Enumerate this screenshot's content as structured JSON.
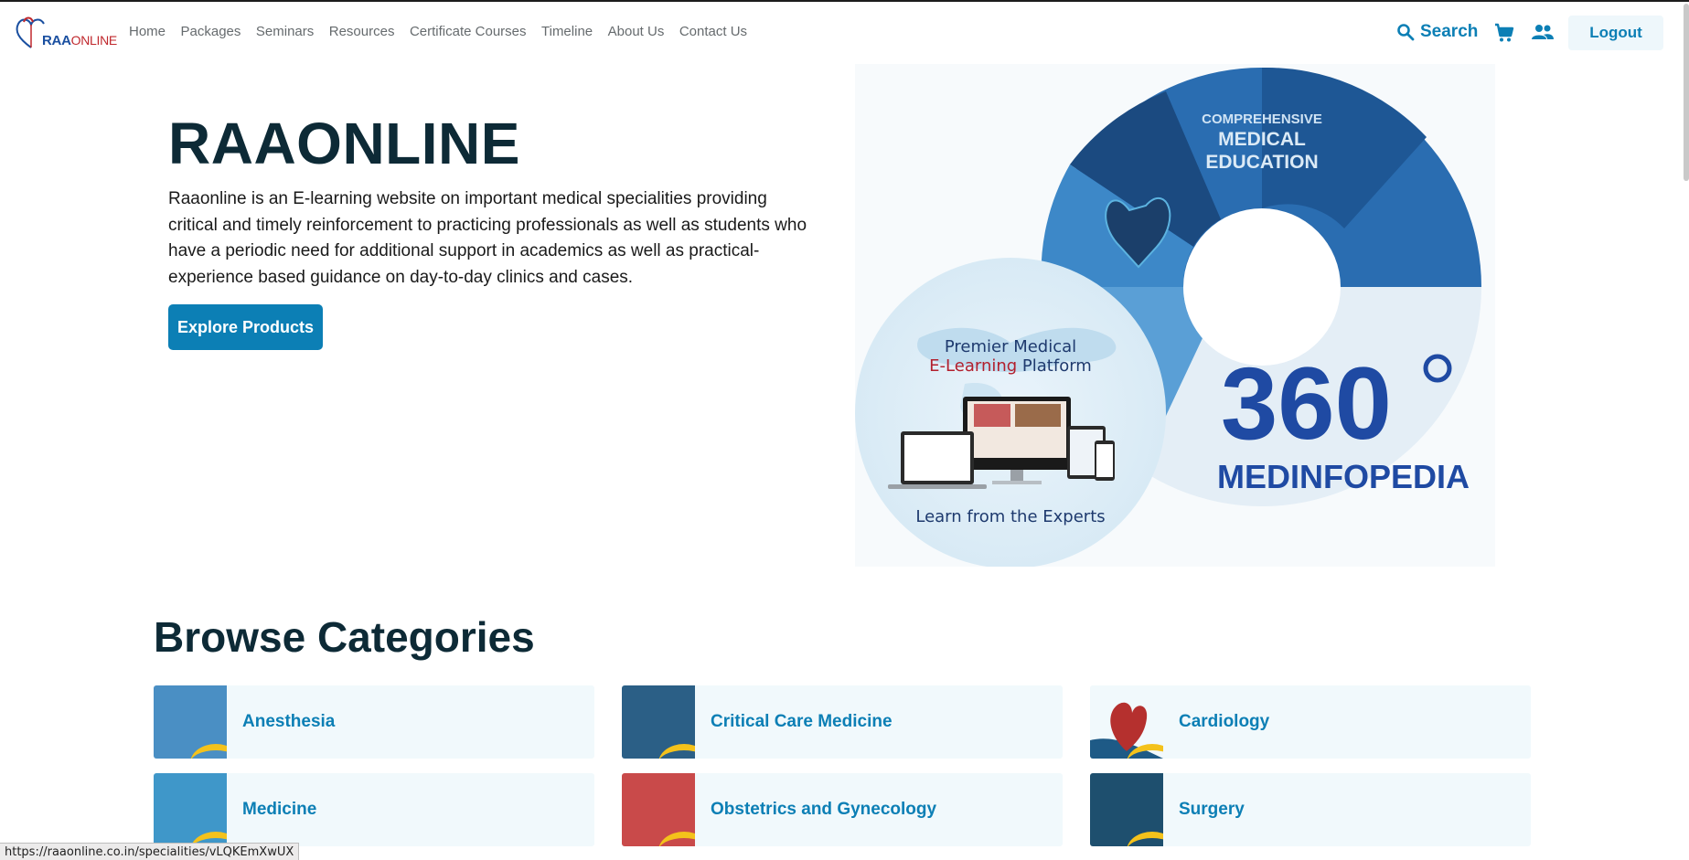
{
  "brand": {
    "logo_text_primary": "RAA",
    "logo_text_secondary": "ONLINE"
  },
  "nav": {
    "links": [
      "Home",
      "Packages",
      "Seminars",
      "Resources",
      "Certificate Courses",
      "Timeline",
      "About Us",
      "Contact Us"
    ],
    "search_label": "Search",
    "logout_label": "Logout"
  },
  "hero": {
    "title": "RAAONLINE",
    "description": "Raaonline is an E-learning website on important medical specialities providing critical and timely reinforcement to practicing professionals as well as students who have a periodic need for additional support in academics as well as practical-experience based guidance on day-to-day clinics and cases.",
    "cta_label": "Explore Products",
    "graphic": {
      "ring_caption_line1": "COMPREHENSIVE",
      "ring_caption_line2": "MEDICAL",
      "ring_caption_line3": "EDUCATION",
      "circle_caption_line1": "Premier Medical",
      "circle_caption_line2a": "E-Learning",
      "circle_caption_line2b": " Platform",
      "circle_footer": "Learn from the Experts",
      "big_number": "360",
      "big_word": "MEDINFOPEDIA"
    }
  },
  "categories": {
    "title": "Browse Categories",
    "items": [
      {
        "label": "Anesthesia",
        "thumb_color": "#4a8fc4"
      },
      {
        "label": "Critical Care Medicine",
        "thumb_color": "#2b5f86"
      },
      {
        "label": "Cardiology",
        "thumb_color": "#d8e6ef"
      },
      {
        "label": "Medicine",
        "thumb_color": "#3f97c9"
      },
      {
        "label": "Obstetrics and Gynecology",
        "thumb_color": "#c94a4a"
      },
      {
        "label": "Surgery",
        "thumb_color": "#1e4f6e"
      }
    ]
  },
  "status_bar": {
    "url": "https://raaonline.co.in/specialities/vLQKEmXwUX"
  },
  "colors": {
    "accent": "#0c7fb5",
    "heading": "#0d2a36",
    "card_bg": "#f1f9fc",
    "ring_blue": "#2a6db1",
    "deep_blue": "#1f4aa3"
  }
}
